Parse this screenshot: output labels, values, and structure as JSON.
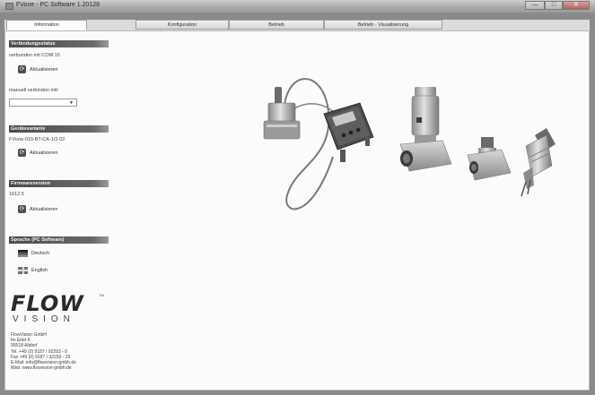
{
  "window": {
    "title": "FVone - PC Software 1.20128",
    "controls": {
      "minimize": "—",
      "maximize": "□",
      "close": "X"
    }
  },
  "tabs": [
    {
      "label": "Information",
      "active": true
    },
    {
      "label": "Konfiguration",
      "active": false
    },
    {
      "label": "Betrieb",
      "active": false
    },
    {
      "label": "Betrieb - Visualisierung",
      "active": false
    }
  ],
  "sidebar": {
    "connection": {
      "header": "Verbindungsstatus",
      "status_text": "verbunden mit COM 15",
      "refresh_label": "Aktualisieren",
      "manual_label": "manuell verbinden mit:",
      "combo_value": ""
    },
    "device": {
      "header": "Gerätevariante",
      "value": "FVone-010-BT-CA-1/2-02",
      "refresh_label": "Aktualisieren"
    },
    "firmware": {
      "header": "Firmwareversion",
      "value": "1612.5",
      "refresh_label": "Aktualisieren"
    },
    "language": {
      "header": "Sprache (PC Software)",
      "options": [
        "Deutsch",
        "English"
      ]
    },
    "logo": {
      "main": "FLOW",
      "sub": "VISION",
      "tm": "TM"
    },
    "address": [
      "FlowVision GmbH",
      "Im Erlet 6",
      "90518 Altdorf",
      "Tel. +49 (0) 9187 / 92293 - 0",
      "Fax +49 (0) 9187 / 92293 - 29",
      "E-Mail: info@flowvision-gmbh.de",
      "Web: www.flowvision-gmbh.de"
    ]
  },
  "colors": {
    "section_header": "#4a4a4a",
    "content_bg": "#fbfbfb",
    "frame": "#8a8a8a"
  }
}
